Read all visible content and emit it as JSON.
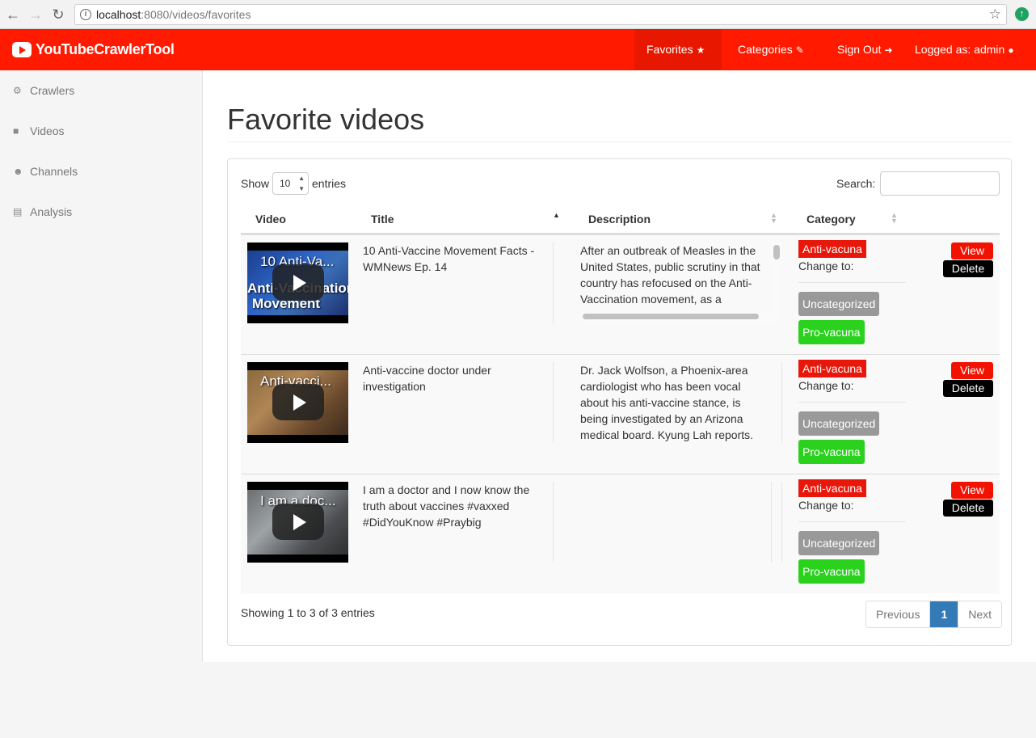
{
  "browser": {
    "url_host": "localhost",
    "url_path": ":8080/videos/favorites",
    "info_icon": "info-icon",
    "bookmark_icon": "star-icon"
  },
  "navbar": {
    "brand": "YouTubeCrawlerTool",
    "favorites": "Favorites",
    "categories": "Categories",
    "sign_out": "Sign Out",
    "logged_as": "Logged as: admin",
    "accent": "#ff1a00"
  },
  "sidebar": {
    "items": [
      {
        "label": "Crawlers",
        "icon": "cogs-icon"
      },
      {
        "label": "Videos",
        "icon": "video-camera-icon"
      },
      {
        "label": "Channels",
        "icon": "users-icon"
      },
      {
        "label": "Analysis",
        "icon": "bar-chart-icon"
      }
    ]
  },
  "page": {
    "title": "Favorite videos"
  },
  "table_controls": {
    "show_label": "Show",
    "page_length": "10",
    "entries_label": "entries",
    "search_label": "Search:",
    "search_value": ""
  },
  "table": {
    "columns": [
      "Video",
      "Title",
      "Description",
      "Category"
    ],
    "rows": [
      {
        "thumb_caption": "10 Anti-Va...",
        "thumb_caption2": "Anti-Vaccination",
        "thumb_caption3": "Movement",
        "title": "10 Anti-Vaccine Movement Facts - WMNews Ep. 14",
        "description": "After an outbreak of Measles in the United States, public scrutiny in that country has refocused on the Anti-Vaccination movement, as a",
        "category": "Anti-vacuna",
        "change_to": "Change to:",
        "options": [
          "Uncategorized",
          "Pro-vacuna"
        ],
        "view": "View",
        "delete": "Delete"
      },
      {
        "thumb_caption": "Anti-vacci...",
        "title": "Anti-vaccine doctor under investigation",
        "description": "Dr. Jack Wolfson, a Phoenix-area cardiologist who has been vocal about his anti-vaccine stance, is being investigated by an Arizona medical board. Kyung Lah reports.",
        "category": "Anti-vacuna",
        "change_to": "Change to:",
        "options": [
          "Uncategorized",
          "Pro-vacuna"
        ],
        "view": "View",
        "delete": "Delete"
      },
      {
        "thumb_caption": "I am a doc...",
        "title": "I am a doctor and I now know the truth about vaccines #vaxxed #DidYouKnow #Praybig",
        "description": "",
        "category": "Anti-vacuna",
        "change_to": "Change to:",
        "options": [
          "Uncategorized",
          "Pro-vacuna"
        ],
        "view": "View",
        "delete": "Delete"
      }
    ]
  },
  "footer": {
    "info": "Showing 1 to 3 of 3 entries",
    "previous": "Previous",
    "current_page": "1",
    "next": "Next"
  },
  "colors": {
    "anti": "#e8170a",
    "uncategorized": "#999999",
    "pro": "#2ad21e",
    "view": "#f21200",
    "delete": "#000000",
    "pager_active": "#337ab7"
  }
}
